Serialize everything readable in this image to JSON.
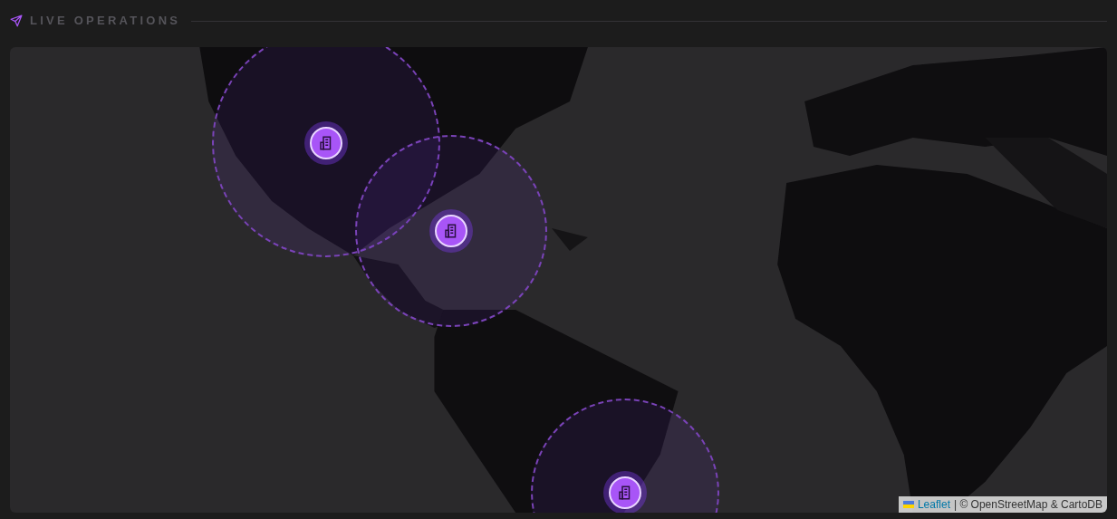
{
  "header": {
    "title": "LIVE OPERATIONS"
  },
  "map": {
    "kind": "picture",
    "attribution": {
      "link": "Leaflet",
      "text": "| © OpenStreetMap & CartoDB"
    }
  }
}
